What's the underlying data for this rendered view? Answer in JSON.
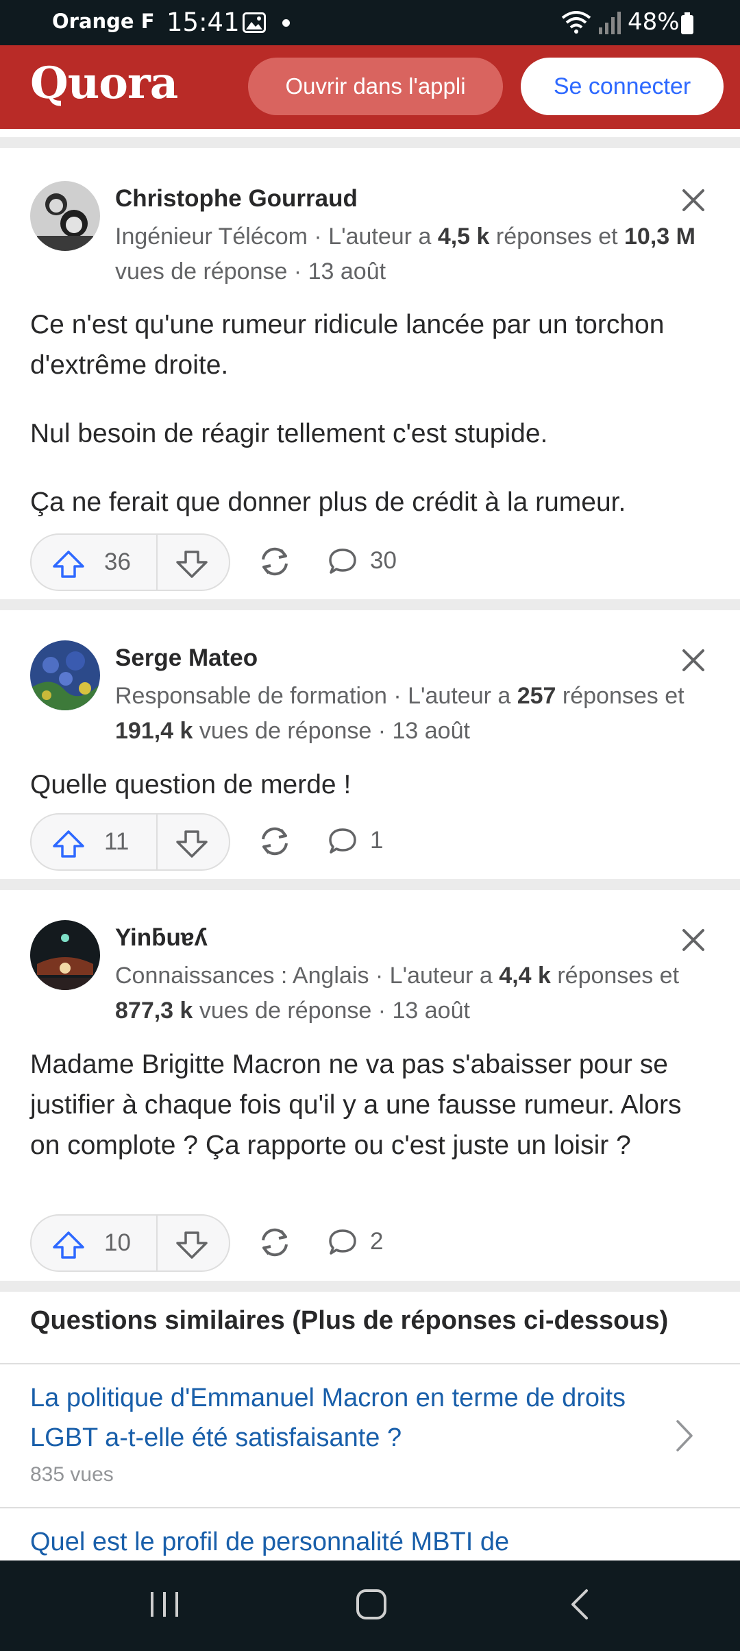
{
  "status_bar": {
    "carrier": "Orange F",
    "time": "15:41",
    "battery": "48%"
  },
  "header": {
    "logo": "Quora",
    "open_app_label": "Ouvrir dans l'appli",
    "login_label": "Se connecter"
  },
  "answers": [
    {
      "author": "Christophe Gourraud",
      "meta_prefix": "Ingénieur Télécom · L'auteur a ",
      "answers_count": "4,5 k",
      "meta_mid": " réponses et ",
      "views": "10,3 M",
      "meta_suffix": " vues de réponse · 13 août",
      "paragraphs": [
        "Ce n'est qu'une rumeur ridicule lancée par un torchon d'extrême droite.",
        "Nul besoin de réagir tellement c'est stupide.",
        "Ça ne ferait que donner plus de crédit à la rumeur."
      ],
      "upvotes": "36",
      "comments": "30"
    },
    {
      "author": "Serge Mateo",
      "meta_prefix": "Responsable de formation · L'auteur a ",
      "answers_count": "257",
      "meta_mid": " réponses et ",
      "views": "191,4 k",
      "meta_suffix": " vues de réponse · 13 août",
      "paragraphs": [
        "Quelle question de merde !"
      ],
      "upvotes": "11",
      "comments": "1"
    },
    {
      "author": "Yinƃuɐʎ",
      "meta_prefix": "Connaissances : Anglais · L'auteur a ",
      "answers_count": "4,4 k",
      "meta_mid": " réponses et ",
      "views": "877,3 k",
      "meta_suffix": " vues de réponse · 13 août",
      "paragraphs": [
        "Madame Brigitte Macron ne va pas s'abaisser pour se justifier à chaque fois qu'il y a une fausse rumeur. Alors on complote ? Ça rapporte ou c'est juste un loisir ?"
      ],
      "upvotes": "10",
      "comments": "2"
    }
  ],
  "related": {
    "title": "Questions similaires (Plus de réponses ci-dessous)",
    "items": [
      {
        "question": "La politique d'Emmanuel Macron en terme de droits LGBT a-t-elle été satisfaisante ?",
        "views": "835 vues"
      },
      {
        "question": "Quel est le profil de personnalité MBTI de"
      }
    ]
  },
  "icons": {
    "upvote": "arrow-up-icon",
    "downvote": "arrow-down-icon",
    "share": "reshare-icon",
    "comment": "comment-bubble-icon",
    "close": "close-icon",
    "chevron": "chevron-right-icon"
  },
  "colors": {
    "brand": "#b92b27",
    "link": "#195faa",
    "accent": "#2e69ff"
  }
}
